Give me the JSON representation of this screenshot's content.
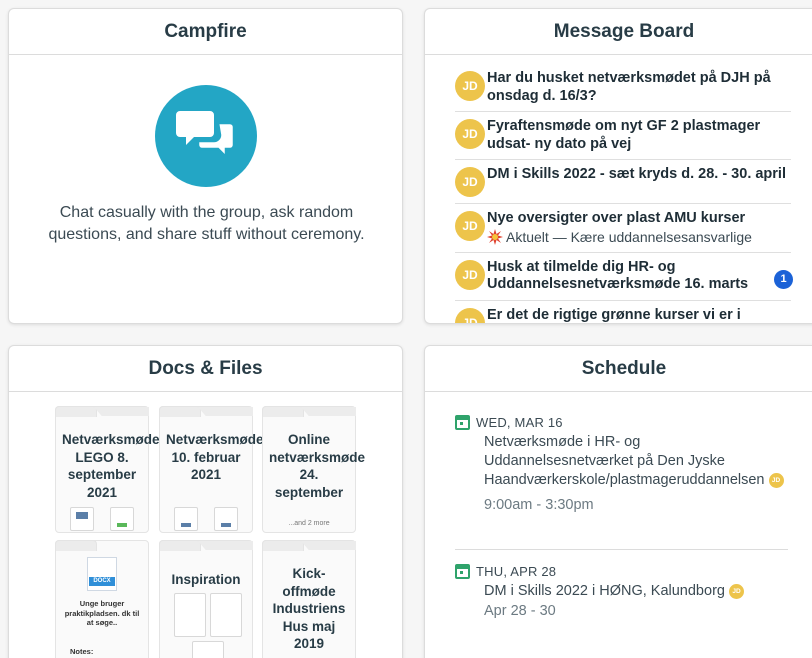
{
  "campfire": {
    "title": "Campfire",
    "description": "Chat casually with the group, ask random questions, and share stuff without ceremony.",
    "icon": "chat-bubbles-icon"
  },
  "message_board": {
    "title": "Message Board",
    "messages": [
      {
        "avatar": "JD",
        "title": "Har du husket netværksmødet på DJH på onsdag d. 16/3?"
      },
      {
        "avatar": "JD",
        "title": "Fyraftensmøde om nyt GF 2 plastmager udsat- ny dato på vej"
      },
      {
        "avatar": "JD",
        "title": "DM i Skills 2022 - sæt kryds d. 28. - 30. april"
      },
      {
        "avatar": "JD",
        "title": "Nye oversigter over plast AMU kurser",
        "subtitle": "Aktuelt — Kære uddannelsesansvarlige"
      },
      {
        "avatar": "JD",
        "title": "Husk at tilmelde dig HR- og Uddannelsesnetværksmøde 16. marts",
        "badge": "1"
      },
      {
        "avatar": "JD",
        "title": "Er det de rigtige grønne kurser vi er i"
      }
    ]
  },
  "docs": {
    "title": "Docs & Files",
    "folders": [
      {
        "name": "Netværksmøde LEGO 8. september 2021"
      },
      {
        "name": "Netværksmøde 10. februar 2021"
      },
      {
        "name": "Online netværksmøde 24. september",
        "more": "...and 2 more"
      },
      {
        "doc_label": "DOCX",
        "text": "Unge bruger praktikpladsen. dk til at søge..",
        "notes": "Notes:"
      },
      {
        "name": "Inspiration"
      },
      {
        "name": "Kick-offmøde Industriens Hus maj 2019"
      }
    ]
  },
  "schedule": {
    "title": "Schedule",
    "events": [
      {
        "date": "WED, MAR 16",
        "title": "Netværksmøde i HR- og Uddannelsesnetværket på Den Jyske Haandværkerskole/plastmageruddannelsen",
        "avatar": "JD",
        "time": "9:00am - 3:30pm"
      },
      {
        "date": "THU, APR 28",
        "title": "DM i Skills 2022 i HØNG, Kalundborg",
        "avatar": "JD",
        "time": "Apr 28 - 30"
      }
    ]
  },
  "colors": {
    "campfire_icon_bg": "#23a6c5",
    "avatar_bg": "#edc44b",
    "badge_bg": "#1b62d7",
    "calendar_green": "#2fa36b"
  }
}
